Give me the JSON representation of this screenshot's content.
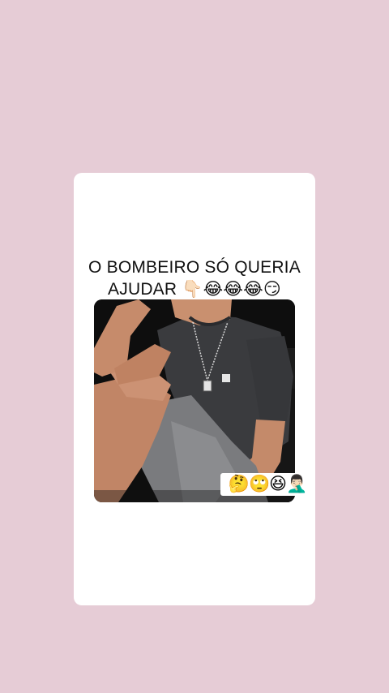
{
  "post": {
    "caption_line1": "O BOMBEIRO SÓ QUERIA",
    "caption_line2": "AJUDAR 👇🏻😂😂😂😏",
    "sticker_emojis": "🤔🙄😆🤦🏻‍♂️"
  },
  "colors": {
    "background": "#e6ccd6",
    "card": "#ffffff",
    "caption_text": "#111111"
  }
}
